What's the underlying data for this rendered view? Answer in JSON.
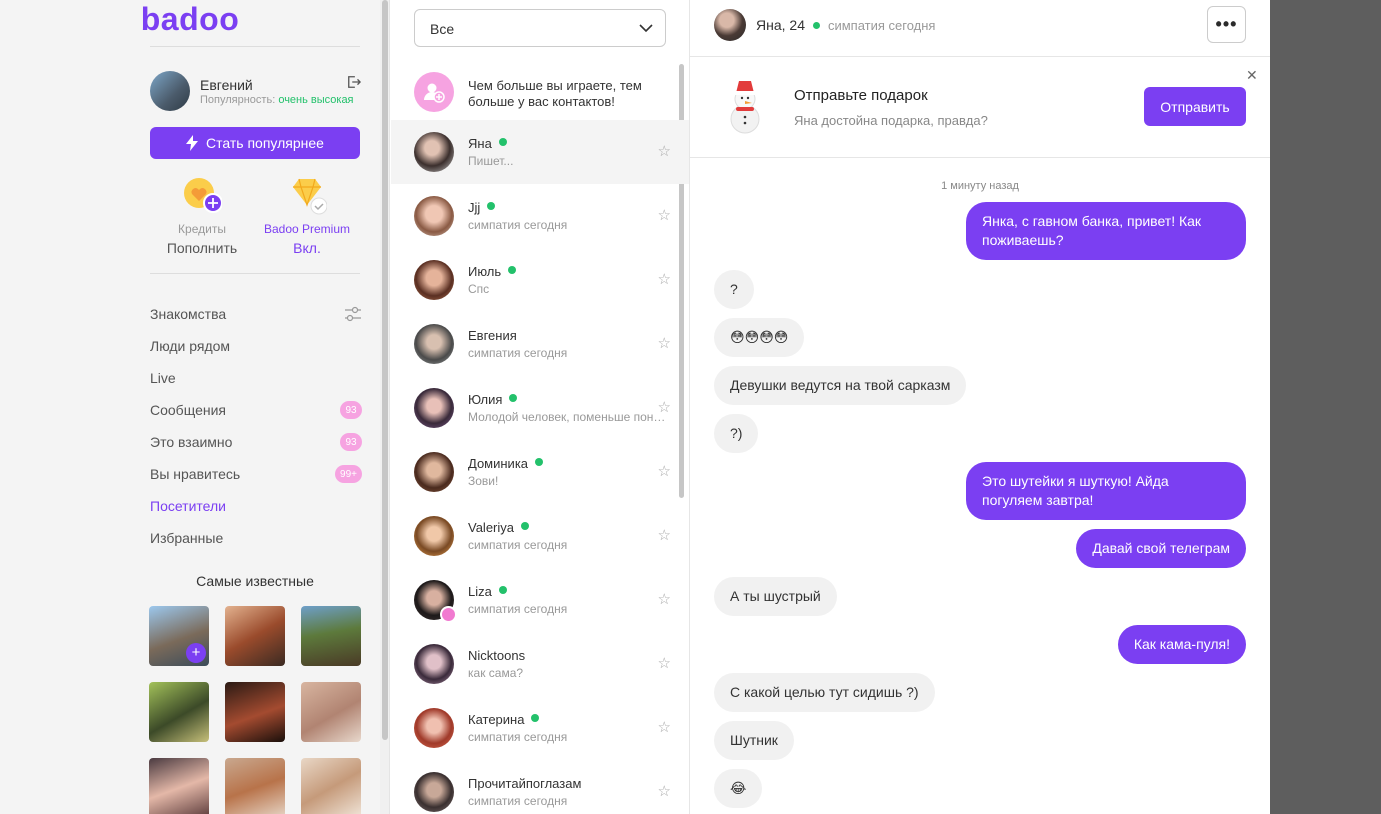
{
  "sidebar": {
    "logo": "badoo",
    "user": {
      "name": "Евгений",
      "popularity_label": "Популярность:",
      "popularity_value": "очень высокая"
    },
    "popular_button": "Стать популярнее",
    "credits": {
      "label": "Кредиты",
      "action": "Пополнить"
    },
    "premium": {
      "label": "Badoo Premium",
      "status": "Вкл."
    },
    "nav": [
      {
        "label": "Знакомства",
        "badge": ""
      },
      {
        "label": "Люди рядом",
        "badge": ""
      },
      {
        "label": "Live",
        "badge": ""
      },
      {
        "label": "Сообщения",
        "badge": "93"
      },
      {
        "label": "Это взаимно",
        "badge": "93"
      },
      {
        "label": "Вы нравитесь",
        "badge": "99+"
      },
      {
        "label": "Посетители",
        "badge": ""
      },
      {
        "label": "Избранные",
        "badge": ""
      }
    ],
    "famous_title": "Самые известные"
  },
  "list": {
    "filter": "Все",
    "promo": "Чем больше вы играете, тем больше у вас контактов!",
    "conversations": [
      {
        "name": "Яна",
        "sub": "Пишет...",
        "online": true
      },
      {
        "name": "Jjj",
        "sub": "симпатия сегодня",
        "online": true
      },
      {
        "name": "Июль",
        "sub": "Спс",
        "online": true
      },
      {
        "name": "Евгения",
        "sub": "симпатия сегодня",
        "online": false
      },
      {
        "name": "Юлия",
        "sub": "Молодой человек, поменьше понтов",
        "online": true
      },
      {
        "name": "Доминика",
        "sub": "Зови!",
        "online": true
      },
      {
        "name": "Valeriya",
        "sub": "симпатия сегодня",
        "online": true
      },
      {
        "name": "Liza",
        "sub": "симпатия сегодня",
        "online": true
      },
      {
        "name": "Nicktoons",
        "sub": "как сама?",
        "online": false
      },
      {
        "name": "Катерина",
        "sub": "симпатия сегодня",
        "online": true
      },
      {
        "name": "Прочитайпоглазам",
        "sub": "симпатия сегодня",
        "online": false
      }
    ]
  },
  "chat": {
    "header": {
      "name": "Яна, 24",
      "status": "симпатия сегодня"
    },
    "gift": {
      "title": "Отправьте подарок",
      "subtitle": "Яна достойна подарка, правда?",
      "button": "Отправить"
    },
    "timestamp": "1 минуту назад",
    "messages": [
      {
        "dir": "out",
        "text": "Янка, с гавном банка, привет! Как поживаешь?"
      },
      {
        "dir": "in",
        "text": "?"
      },
      {
        "dir": "in",
        "text": "😳😳😳😳"
      },
      {
        "dir": "in",
        "text": "Девушки ведутся на твой сарказм"
      },
      {
        "dir": "in",
        "text": "?)"
      },
      {
        "dir": "out",
        "text": "Это шутейки я шуткую! Айда погуляем завтра!"
      },
      {
        "dir": "out",
        "text": "Давай свой телеграм"
      },
      {
        "dir": "in",
        "text": "А ты шустрый"
      },
      {
        "dir": "out",
        "text": "Как кама-пуля!"
      },
      {
        "dir": "in",
        "text": "С какой целью тут сидишь ?)"
      },
      {
        "dir": "in",
        "text": "Шутник"
      },
      {
        "dir": "in",
        "text": "😂"
      }
    ]
  },
  "colors": {
    "accent": "#7b3ff2",
    "online": "#23c16b",
    "badge": "#f6a3e1"
  }
}
